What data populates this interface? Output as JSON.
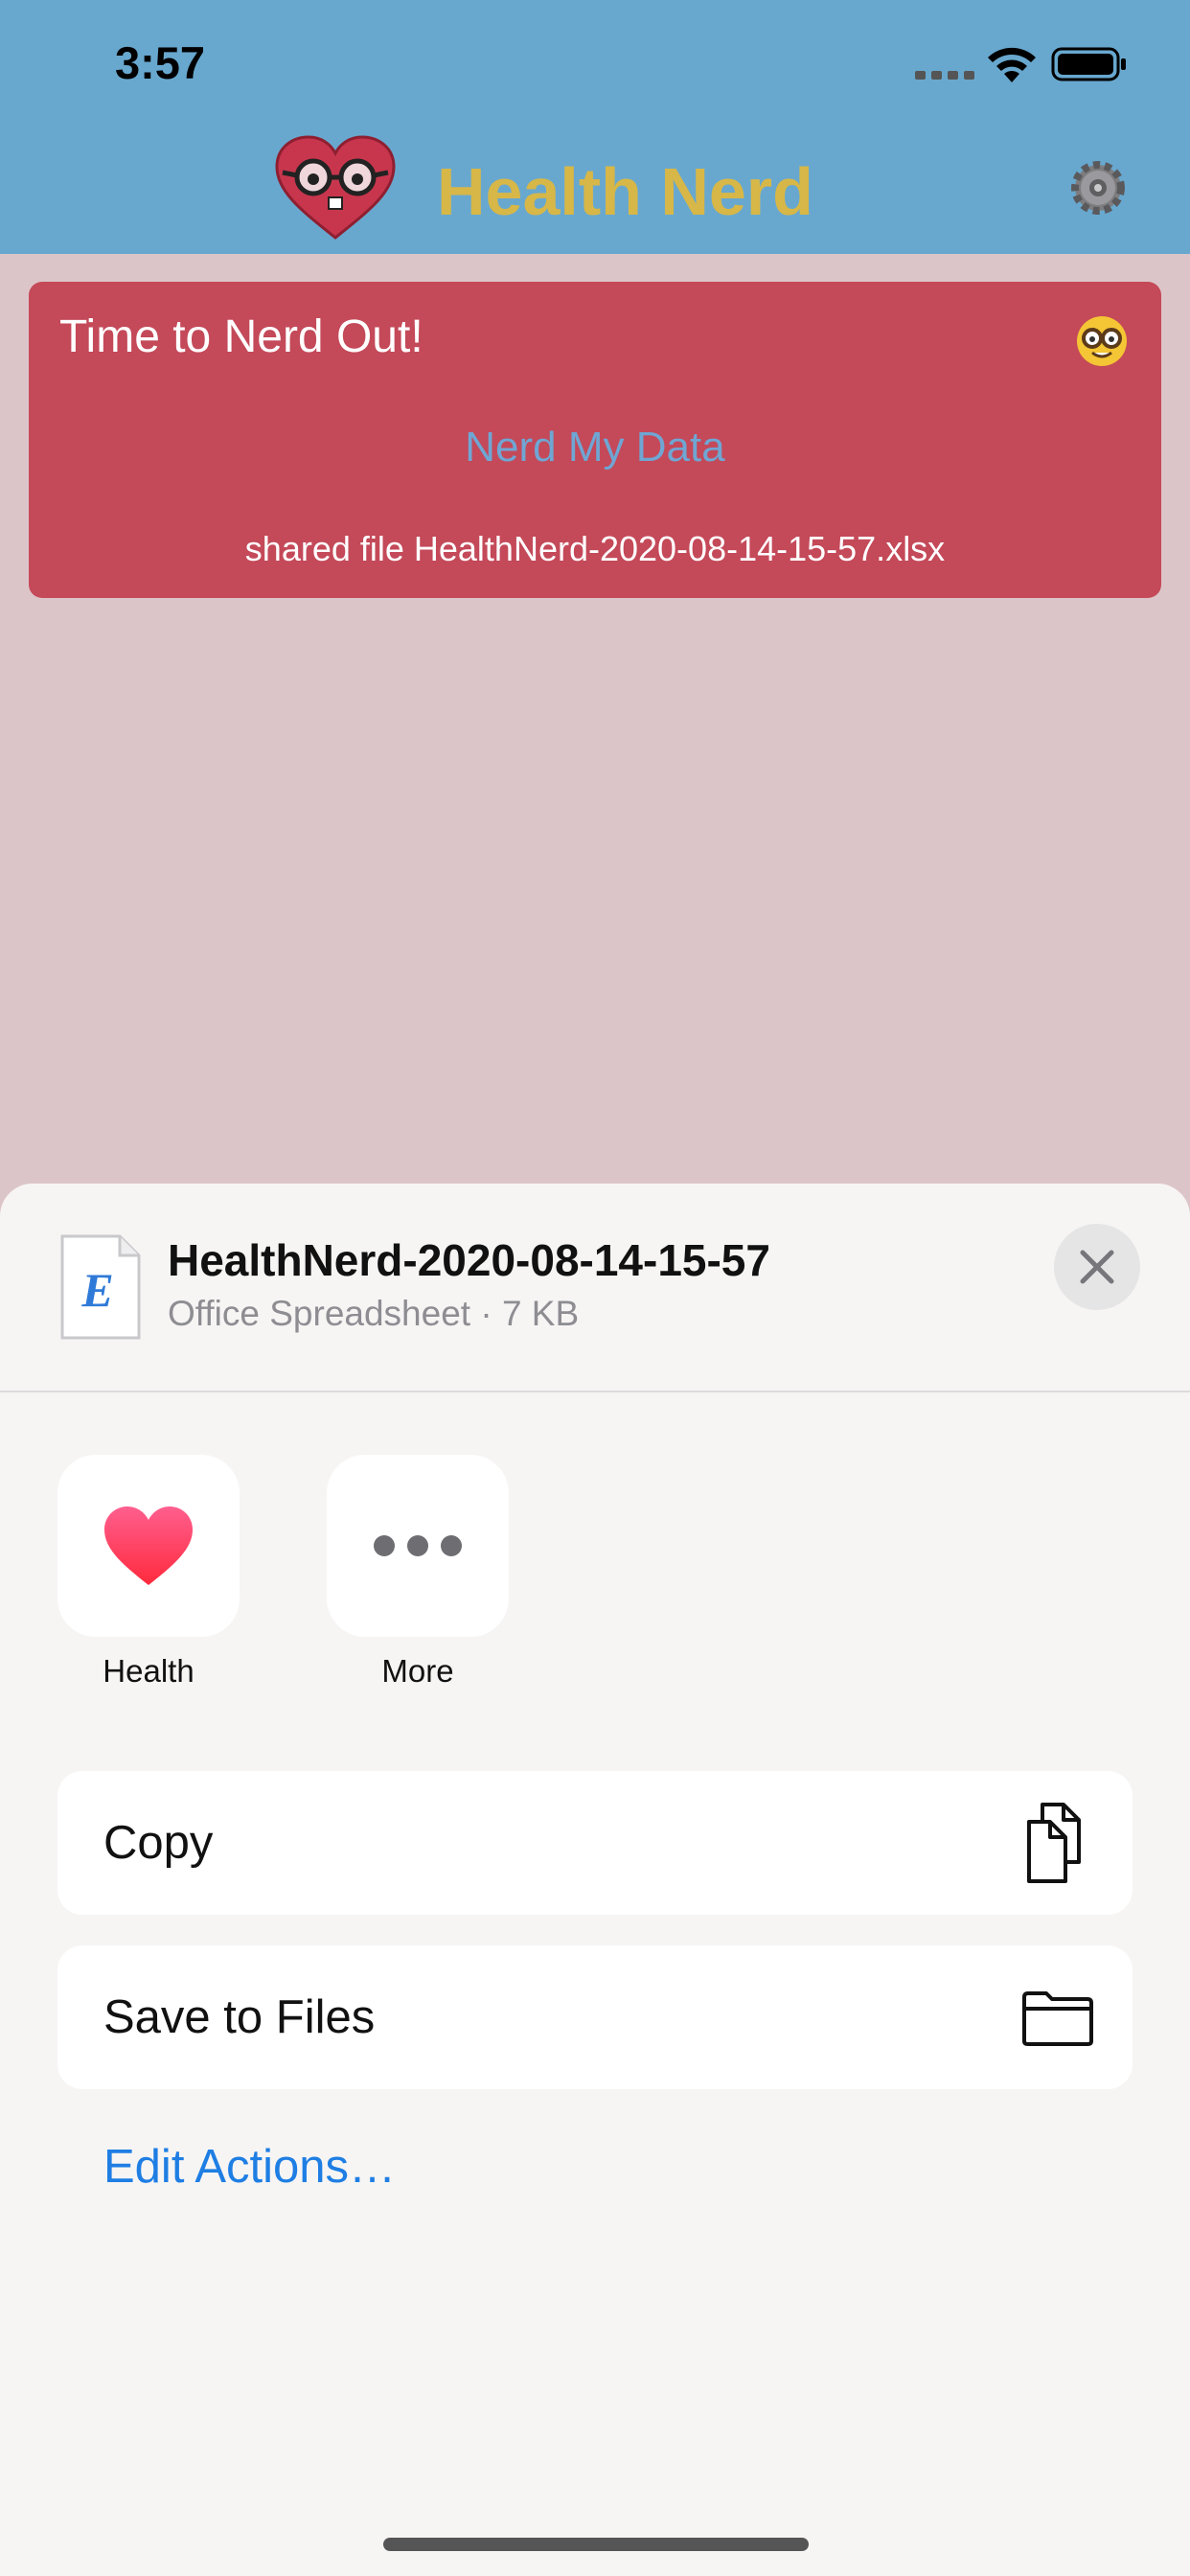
{
  "status_bar": {
    "time": "3:57"
  },
  "header": {
    "app_title": "Health Nerd",
    "background_color": "#68a8cf",
    "title_color": "#d7b747"
  },
  "card": {
    "title": "Time to Nerd Out!",
    "link_label": "Nerd My Data",
    "status_text": "shared file HealthNerd-2020-08-14-15-57.xlsx",
    "background_color": "#c44959"
  },
  "share_sheet": {
    "file_name": "HealthNerd-2020-08-14-15-57",
    "file_subtitle": "Office Spreadsheet · 7 KB",
    "file_icon_letter": "E",
    "apps": [
      {
        "label": "Health",
        "icon": "heart-icon"
      },
      {
        "label": "More",
        "icon": "more-icon"
      }
    ],
    "actions": [
      {
        "label": "Copy",
        "icon": "copy-icon"
      },
      {
        "label": "Save to Files",
        "icon": "folder-icon"
      }
    ],
    "edit_actions_label": "Edit Actions…",
    "accent_color": "#1e7ee3"
  }
}
